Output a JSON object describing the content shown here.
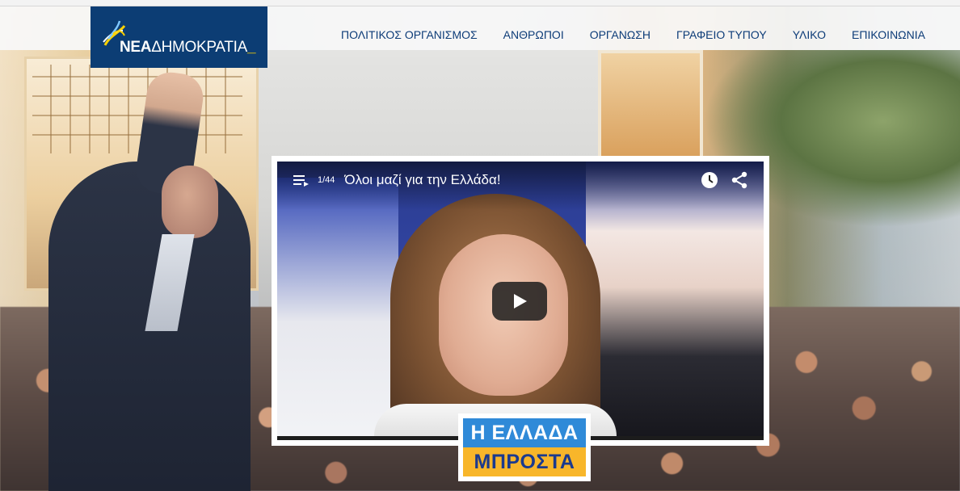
{
  "site": {
    "logo": {
      "bold": "ΝΕΑ",
      "thin": "ΔΗΜΟΚΡΑΤΙΑ",
      "cursor": "_"
    }
  },
  "nav": {
    "items": [
      {
        "label": "ΠΟΛΙΤΙΚΟΣ ΟΡΓΑΝΙΣΜΟΣ"
      },
      {
        "label": "ΑΝΘΡΩΠΟΙ"
      },
      {
        "label": "ΟΡΓΑΝΩΣΗ"
      },
      {
        "label": "ΓΡΑΦΕΙΟ ΤΥΠΟΥ"
      },
      {
        "label": "ΥΛΙΚΟ"
      },
      {
        "label": "ΕΠΙΚΟΙΝΩΝΙΑ"
      }
    ]
  },
  "video": {
    "count": "1/44",
    "title": "Όλοι μαζί για την Ελλάδα!",
    "icons": [
      "playlist-icon",
      "watch-later-icon",
      "share-icon",
      "play-icon"
    ]
  },
  "badge": {
    "line1": "Η ΕΛΛΑΔΑ",
    "line2": "ΜΠΡΟΣΤΑ"
  },
  "colors": {
    "brand_blue": "#0c3d74",
    "nav_text": "#0d3c78",
    "badge_blue": "#2f8ad8",
    "badge_yellow": "#f8b62a"
  }
}
